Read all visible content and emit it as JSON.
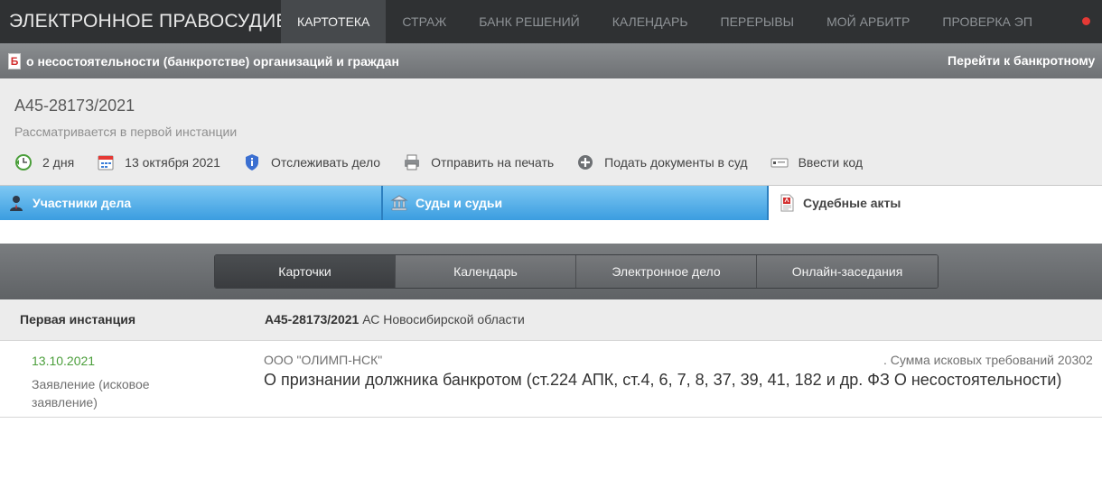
{
  "topnav": {
    "brand": "ЭЛЕКТРОННОЕ ПРАВОСУДИЕ",
    "items": [
      {
        "label": "КАРТОТЕКА",
        "active": true
      },
      {
        "label": "СТРАЖ"
      },
      {
        "label": "БАНК РЕШЕНИЙ"
      },
      {
        "label": "КАЛЕНДАРЬ"
      },
      {
        "label": "ПЕРЕРЫВЫ"
      },
      {
        "label": "МОЙ АРБИТР"
      },
      {
        "label": "ПРОВЕРКА ЭП"
      }
    ],
    "indicator_color": "#e53935"
  },
  "bankbar": {
    "icon_letter": "Б",
    "title": "о несостоятельности (банкротстве) организаций и граждан",
    "link": "Перейти к банкротному"
  },
  "case": {
    "number": "А45-28173/2021",
    "status": "Рассматривается в первой инстанции",
    "actions": [
      {
        "icon": "clock-icon",
        "label": "2 дня"
      },
      {
        "icon": "calendar-icon",
        "label": "13 октября 2021"
      },
      {
        "icon": "shield-icon",
        "label": "Отслеживать дело"
      },
      {
        "icon": "printer-icon",
        "label": "Отправить на печать"
      },
      {
        "icon": "plus-circle-icon",
        "label": "Подать документы в суд"
      },
      {
        "icon": "keycard-icon",
        "label": "Ввести код"
      }
    ]
  },
  "tabs": [
    {
      "icon": "person-icon",
      "label": "Участники дела"
    },
    {
      "icon": "courthouse-icon",
      "label": "Суды и судьи"
    },
    {
      "icon": "pdf-document-icon",
      "label": "Судебные акты",
      "active": true
    }
  ],
  "subtabs": [
    {
      "label": "Карточки",
      "active": true
    },
    {
      "label": "Календарь"
    },
    {
      "label": "Электронное дело"
    },
    {
      "label": "Онлайн-заседания"
    }
  ],
  "instance": {
    "label": "Первая инстанция",
    "case_number": "А45-28173/2021",
    "court": "АС Новосибирской области"
  },
  "document": {
    "date": "13.10.2021",
    "type": "Заявление (исковое заявление)",
    "party": "ООО \"ОЛИМП-НСК\"",
    "sum": ". Сумма исковых требований 20302",
    "subject": "О признании должника банкротом (ст.224 АПК, ст.4, 6, 7, 8, 37, 39, 41, 182 и др. ФЗ О несостоятельности)"
  },
  "colors": {
    "tab_blue": "#3b9de0",
    "date_green": "#4a9e3a",
    "nav_dark": "#2f3133"
  }
}
